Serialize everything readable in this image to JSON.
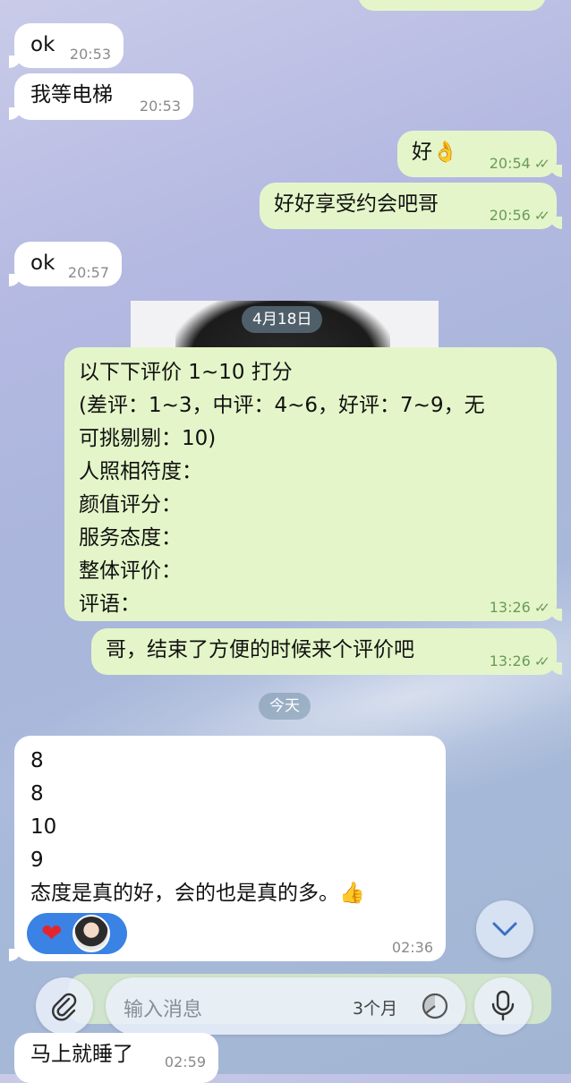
{
  "messages": [
    {
      "text": "ok",
      "time": "20:53"
    },
    {
      "text": "我等电梯",
      "time": "20:53"
    },
    {
      "text": "好👌",
      "time": "20:54"
    },
    {
      "text": "好好享受约会吧哥",
      "time": "20:56"
    },
    {
      "text": "ok",
      "time": "20:57"
    },
    {
      "lines": [
        "以下下评价 1~10 打分",
        "(差评：1~3，中评：4~6，好评：7~9，无",
        "可挑剔剔：10)",
        "人照相符度：",
        "颜值评分：",
        "服务态度：",
        "整体评价：",
        "评语："
      ],
      "time": "13:26"
    },
    {
      "text": "哥，结束了方便的时候来个评价吧",
      "time": "13:26"
    },
    {
      "lines": [
        "8",
        "8",
        "10",
        "9",
        "态度是真的好，会的也是真的多。👍"
      ],
      "time": "02:36"
    },
    {
      "text": "马上就睡了",
      "time": "02:59"
    }
  ],
  "dates": [
    "4月18日",
    "今天"
  ],
  "read_mark": "✓✓",
  "reaction": {
    "emoji": "❤"
  },
  "input": {
    "placeholder": "输入消息",
    "timer": "3个月"
  },
  "icons": {
    "attach": "paperclip-icon",
    "mic": "microphone-icon",
    "timer": "timer-icon",
    "scroll": "chevron-down-icon"
  }
}
